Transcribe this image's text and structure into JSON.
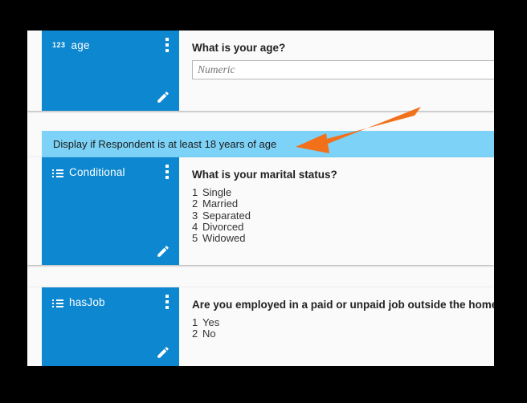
{
  "colors": {
    "card_accent": "#0d87cf",
    "banner": "#7dd3f7",
    "arrow": "#f2701a",
    "page_background": "#fafafa",
    "outer_border": "#000000"
  },
  "display_condition": {
    "label": "Display if  Respondent is at least 18 years of age"
  },
  "annotation": {
    "arrow_name": "orange-pointer-arrow"
  },
  "questions": [
    {
      "variable_name": "age",
      "icon": "numeric-123-icon",
      "icon_glyph": "123",
      "question_text": "What is your age?",
      "input_placeholder": "Numeric",
      "menu_icon": "kebab-menu-icon",
      "edit_icon": "pencil-edit-icon",
      "answers": []
    },
    {
      "variable_name": "Conditional",
      "icon": "list-icon",
      "icon_glyph": "",
      "question_text": "What is your marital status?",
      "input_placeholder": "",
      "menu_icon": "kebab-menu-icon",
      "edit_icon": "pencil-edit-icon",
      "answers": [
        {
          "num": "1",
          "label": "Single"
        },
        {
          "num": "2",
          "label": "Married"
        },
        {
          "num": "3",
          "label": "Separated"
        },
        {
          "num": "4",
          "label": "Divorced"
        },
        {
          "num": "5",
          "label": "Widowed"
        }
      ]
    },
    {
      "variable_name": "hasJob",
      "icon": "list-icon",
      "icon_glyph": "",
      "question_text": "Are you employed in a paid or unpaid job outside the home?",
      "input_placeholder": "",
      "menu_icon": "kebab-menu-icon",
      "edit_icon": "pencil-edit-icon",
      "answers": [
        {
          "num": "1",
          "label": "Yes"
        },
        {
          "num": "2",
          "label": "No"
        }
      ]
    }
  ]
}
